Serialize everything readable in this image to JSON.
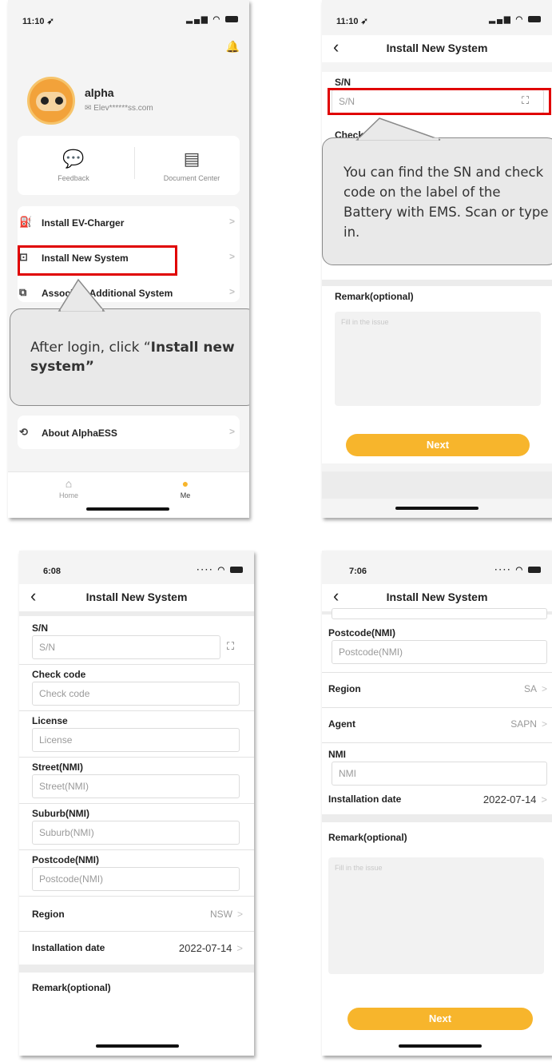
{
  "screen1": {
    "time": "11:10 ➶",
    "user_name": "alpha",
    "user_email": "Elev******ss.com",
    "quick": [
      {
        "label": "Feedback",
        "icon": "feedback-icon"
      },
      {
        "label": "Document Center",
        "icon": "document-icon"
      }
    ],
    "menu": [
      {
        "label": "Install EV-Charger",
        "icon": "ev-charger-icon"
      },
      {
        "label": "Install New System",
        "icon": "install-system-icon"
      },
      {
        "label": "Associate Additional System",
        "icon": "associate-icon"
      },
      {
        "label": "About AlphaESS",
        "icon": "about-icon"
      }
    ],
    "callout_prefix": "After login, click “",
    "callout_bold": "Install new system”",
    "tabs": [
      {
        "label": "Home",
        "icon": "home-icon"
      },
      {
        "label": "Me",
        "icon": "me-icon"
      }
    ],
    "accent": "#f7b52c",
    "highlight": "#e00000"
  },
  "screen2": {
    "time": "11:10 ➶",
    "title": "Install New System",
    "sn_label": "S/N",
    "sn_placeholder": "S/N",
    "check_label_partial": "Check",
    "callout": "You can find the SN  and check code on the label of the Battery with EMS. Scan or type in.",
    "remark_label": "Remark(optional)",
    "remark_placeholder": "Fill in the issue",
    "next": "Next"
  },
  "screen3": {
    "time": "6:08",
    "title": "Install New System",
    "fields": [
      {
        "label": "S/N",
        "placeholder": "S/N"
      },
      {
        "label": "Check code",
        "placeholder": "Check code"
      },
      {
        "label": "License",
        "placeholder": "License"
      },
      {
        "label": "Street(NMI)",
        "placeholder": "Street(NMI)"
      },
      {
        "label": "Suburb(NMI)",
        "placeholder": "Suburb(NMI)"
      },
      {
        "label": "Postcode(NMI)",
        "placeholder": "Postcode(NMI)"
      }
    ],
    "region_label": "Region",
    "region_value": "NSW",
    "install_label": "Installation date",
    "install_value": "2022-07-14",
    "remark_label": "Remark(optional)"
  },
  "screen4": {
    "time": "7:06",
    "title": "Install New System",
    "postcode_label": "Postcode(NMI)",
    "postcode_placeholder": "Postcode(NMI)",
    "region_label": "Region",
    "region_value": "SA",
    "agent_label": "Agent",
    "agent_value": "SAPN",
    "nmi_label": "NMI",
    "nmi_placeholder": "NMI",
    "install_label": "Installation date",
    "install_value": "2022-07-14",
    "remark_label": "Remark(optional)",
    "remark_placeholder": "Fill in the issue",
    "next": "Next"
  }
}
